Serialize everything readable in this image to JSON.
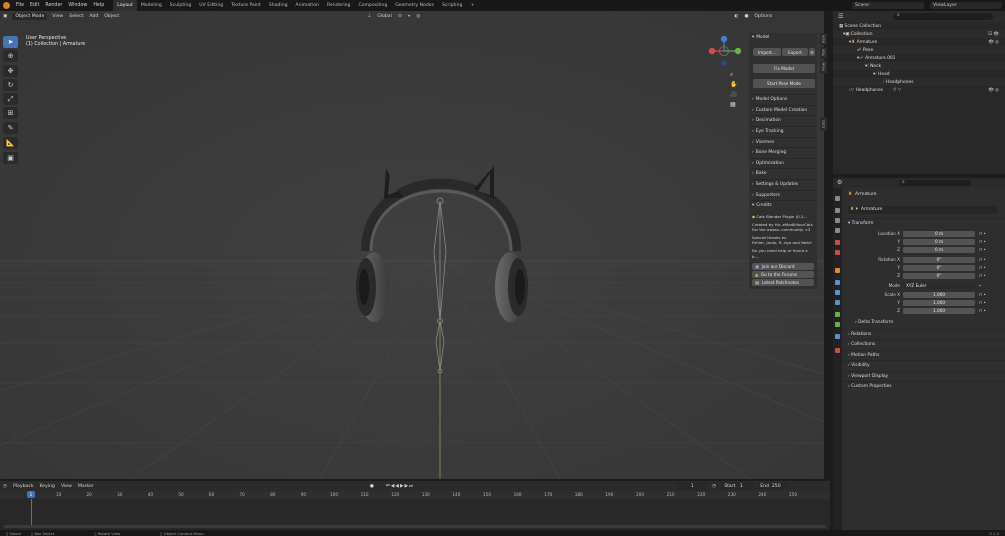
{
  "topbar": {
    "menus": [
      "File",
      "Edit",
      "Render",
      "Window",
      "Help"
    ],
    "workspaces": [
      "Layout",
      "Modeling",
      "Sculpting",
      "UV Editing",
      "Texture Paint",
      "Shading",
      "Animation",
      "Rendering",
      "Compositing",
      "Geometry Nodes",
      "Scripting"
    ],
    "active_workspace": "Layout",
    "add_tab": "+",
    "scene": "Scene",
    "view_layer": "ViewLayer"
  },
  "viewport_header": {
    "mode": "Object Mode",
    "menus": [
      "View",
      "Select",
      "Add",
      "Object"
    ],
    "orientation": "Global",
    "options": "Options"
  },
  "viewport": {
    "view_name": "User Perspective",
    "collection_info": "(1) Collection | Armature"
  },
  "npanel": {
    "tabs": [
      "Item",
      "Tool",
      "View",
      "Cats"
    ],
    "model_header": "Model",
    "import_label": "Import...",
    "export_label": "Export",
    "fix_model": "Fix Model",
    "start_pose_mode": "Start Pose Mode",
    "sections": [
      "Model Options",
      "Custom Model Creation",
      "Decimation",
      "Eye Tracking",
      "Visemes",
      "Bone Merging",
      "Optimization",
      "Bake",
      "Settings & Updates",
      "Supporters",
      "Credits"
    ],
    "credits_title": "Cats Blender Plugin (0.1...",
    "credits_lines": [
      "Created by Hu..eModItYourCats",
      "For the awsso..community <3",
      "Special thanks to:",
      "Fehler, Jordo, R..riya and Neitri",
      "Do you need help or found a b..."
    ],
    "join_discord": "Join our Discord",
    "forums": "Go to the Forums",
    "patchnotes": "Latest Patchnotes"
  },
  "outliner": {
    "title": "Scene Collection",
    "rows": [
      {
        "label": "Scene Collection",
        "indent": 0
      },
      {
        "label": "Collection",
        "indent": 1
      },
      {
        "label": "Armature",
        "indent": 2
      },
      {
        "label": "Pose",
        "indent": 3
      },
      {
        "label": "Armature.001",
        "indent": 3
      },
      {
        "label": "Neck",
        "indent": 4
      },
      {
        "label": "Head",
        "indent": 5
      },
      {
        "label": "Headphones",
        "indent": 6
      },
      {
        "label": "Headphones",
        "indent": 2
      }
    ]
  },
  "properties": {
    "object_name": "Armature",
    "data_name": "Armature",
    "transform_header": "Transform",
    "location_label": "Location X",
    "location": [
      "0 m",
      "0 m",
      "0 m"
    ],
    "rotation_label": "Rotation X",
    "rotation": [
      "0°",
      "0°",
      "0°"
    ],
    "mode_label": "Mode",
    "mode_value": "XYZ Euler",
    "scale_label": "Scale X",
    "scale": [
      "1.000",
      "1.000",
      "1.000"
    ],
    "axis_y": "Y",
    "axis_z": "Z",
    "delta_transform": "Delta Transform",
    "sections": [
      "Relations",
      "Collections",
      "Motion Paths",
      "Visibility",
      "Viewport Display",
      "Custom Properties"
    ]
  },
  "timeline": {
    "menus": [
      "Playback",
      "Keying",
      "View",
      "Marker"
    ],
    "current_frame": "1",
    "start_label": "Start",
    "start_value": "1",
    "end_label": "End",
    "end_value": "250",
    "ruler_ticks": [
      "1",
      "10",
      "20",
      "30",
      "40",
      "50",
      "60",
      "70",
      "80",
      "90",
      "100",
      "110",
      "120",
      "130",
      "140",
      "150",
      "160",
      "170",
      "180",
      "190",
      "200",
      "210",
      "220",
      "230",
      "240",
      "250"
    ]
  },
  "status": {
    "items": [
      "Select",
      "Box Select",
      "Rotate View",
      "Object Context Menu"
    ],
    "version": "3.1.0"
  },
  "colors": {
    "accent": "#4772b3",
    "header_bg": "#181818",
    "viewport_bg": "#3d3d3d",
    "axis_x": "#d84a4a",
    "axis_y": "#6ab04a",
    "axis_z": "#3f7fd8"
  }
}
